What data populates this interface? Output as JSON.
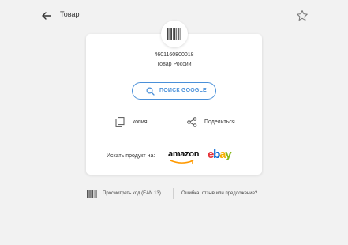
{
  "header": {
    "title": "Товар"
  },
  "product": {
    "code": "4601160800018",
    "country": "Товар России"
  },
  "actions": {
    "google_label": "ПОИСК GOOGLE",
    "copy_label": "копия",
    "share_label": "Поделиться"
  },
  "shops": {
    "search_label": "Искать продукт на:",
    "amazon_label": "amazon",
    "ebay_letters": [
      "e",
      "b",
      "a",
      "y"
    ]
  },
  "footer": {
    "view_code_label": "Просмотреть код (EAN 13)",
    "feedback_label": "Ошибка, отзыв или предложение?"
  },
  "colors": {
    "accent": "#4a90d9",
    "background": "#f2f2f2",
    "ebay_e": "#e53238",
    "ebay_b": "#0064d2",
    "ebay_a": "#f5af02",
    "ebay_y": "#86b817",
    "amazon_smile": "#f90"
  }
}
